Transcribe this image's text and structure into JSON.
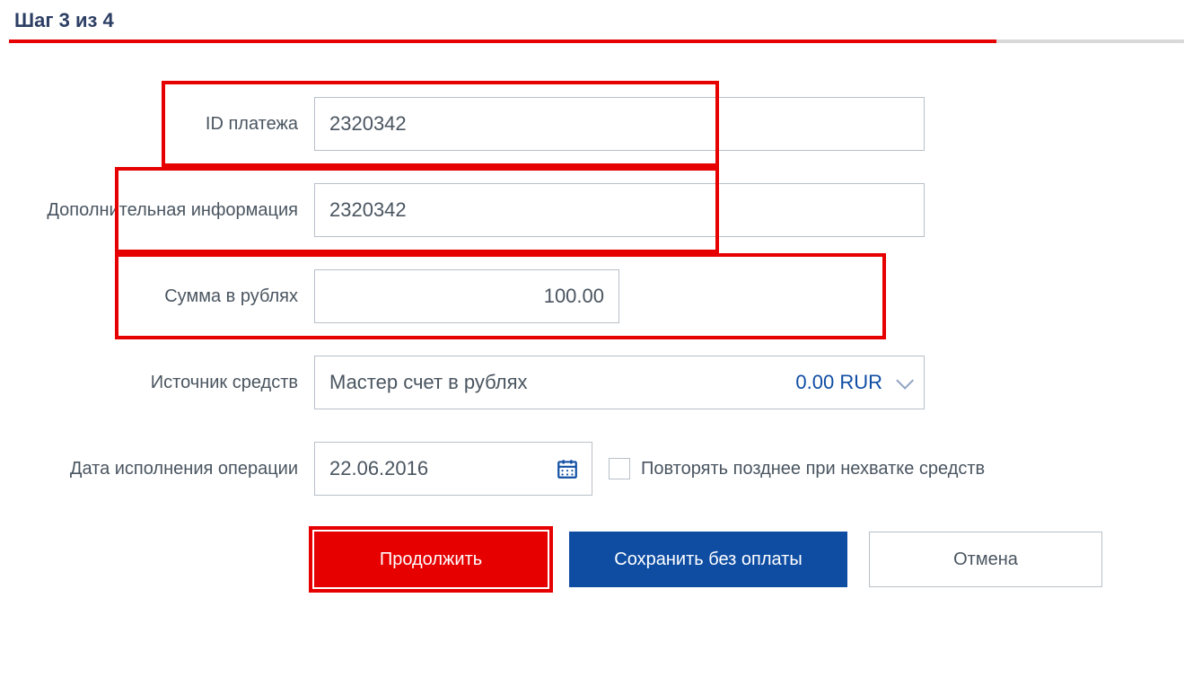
{
  "step": {
    "heading": "Шаг 3 из 4",
    "progressPercent": 84
  },
  "fields": {
    "paymentId": {
      "label": "ID платежа",
      "value": "2320342"
    },
    "extraInfo": {
      "label": "Дополнительная информация",
      "value": "2320342"
    },
    "amount": {
      "label": "Сумма в рублях",
      "value": "100.00"
    },
    "source": {
      "label": "Источник средств",
      "selected": "Мастер счет в рублях",
      "balance": "0.00 RUR"
    },
    "date": {
      "label": "Дата исполнения операции",
      "value": "22.06.2016"
    },
    "retry": {
      "label": "Повторять позднее при нехватке средств",
      "checked": false
    }
  },
  "buttons": {
    "continue": "Продолжить",
    "save": "Сохранить без оплаты",
    "cancel": "Отмена"
  }
}
